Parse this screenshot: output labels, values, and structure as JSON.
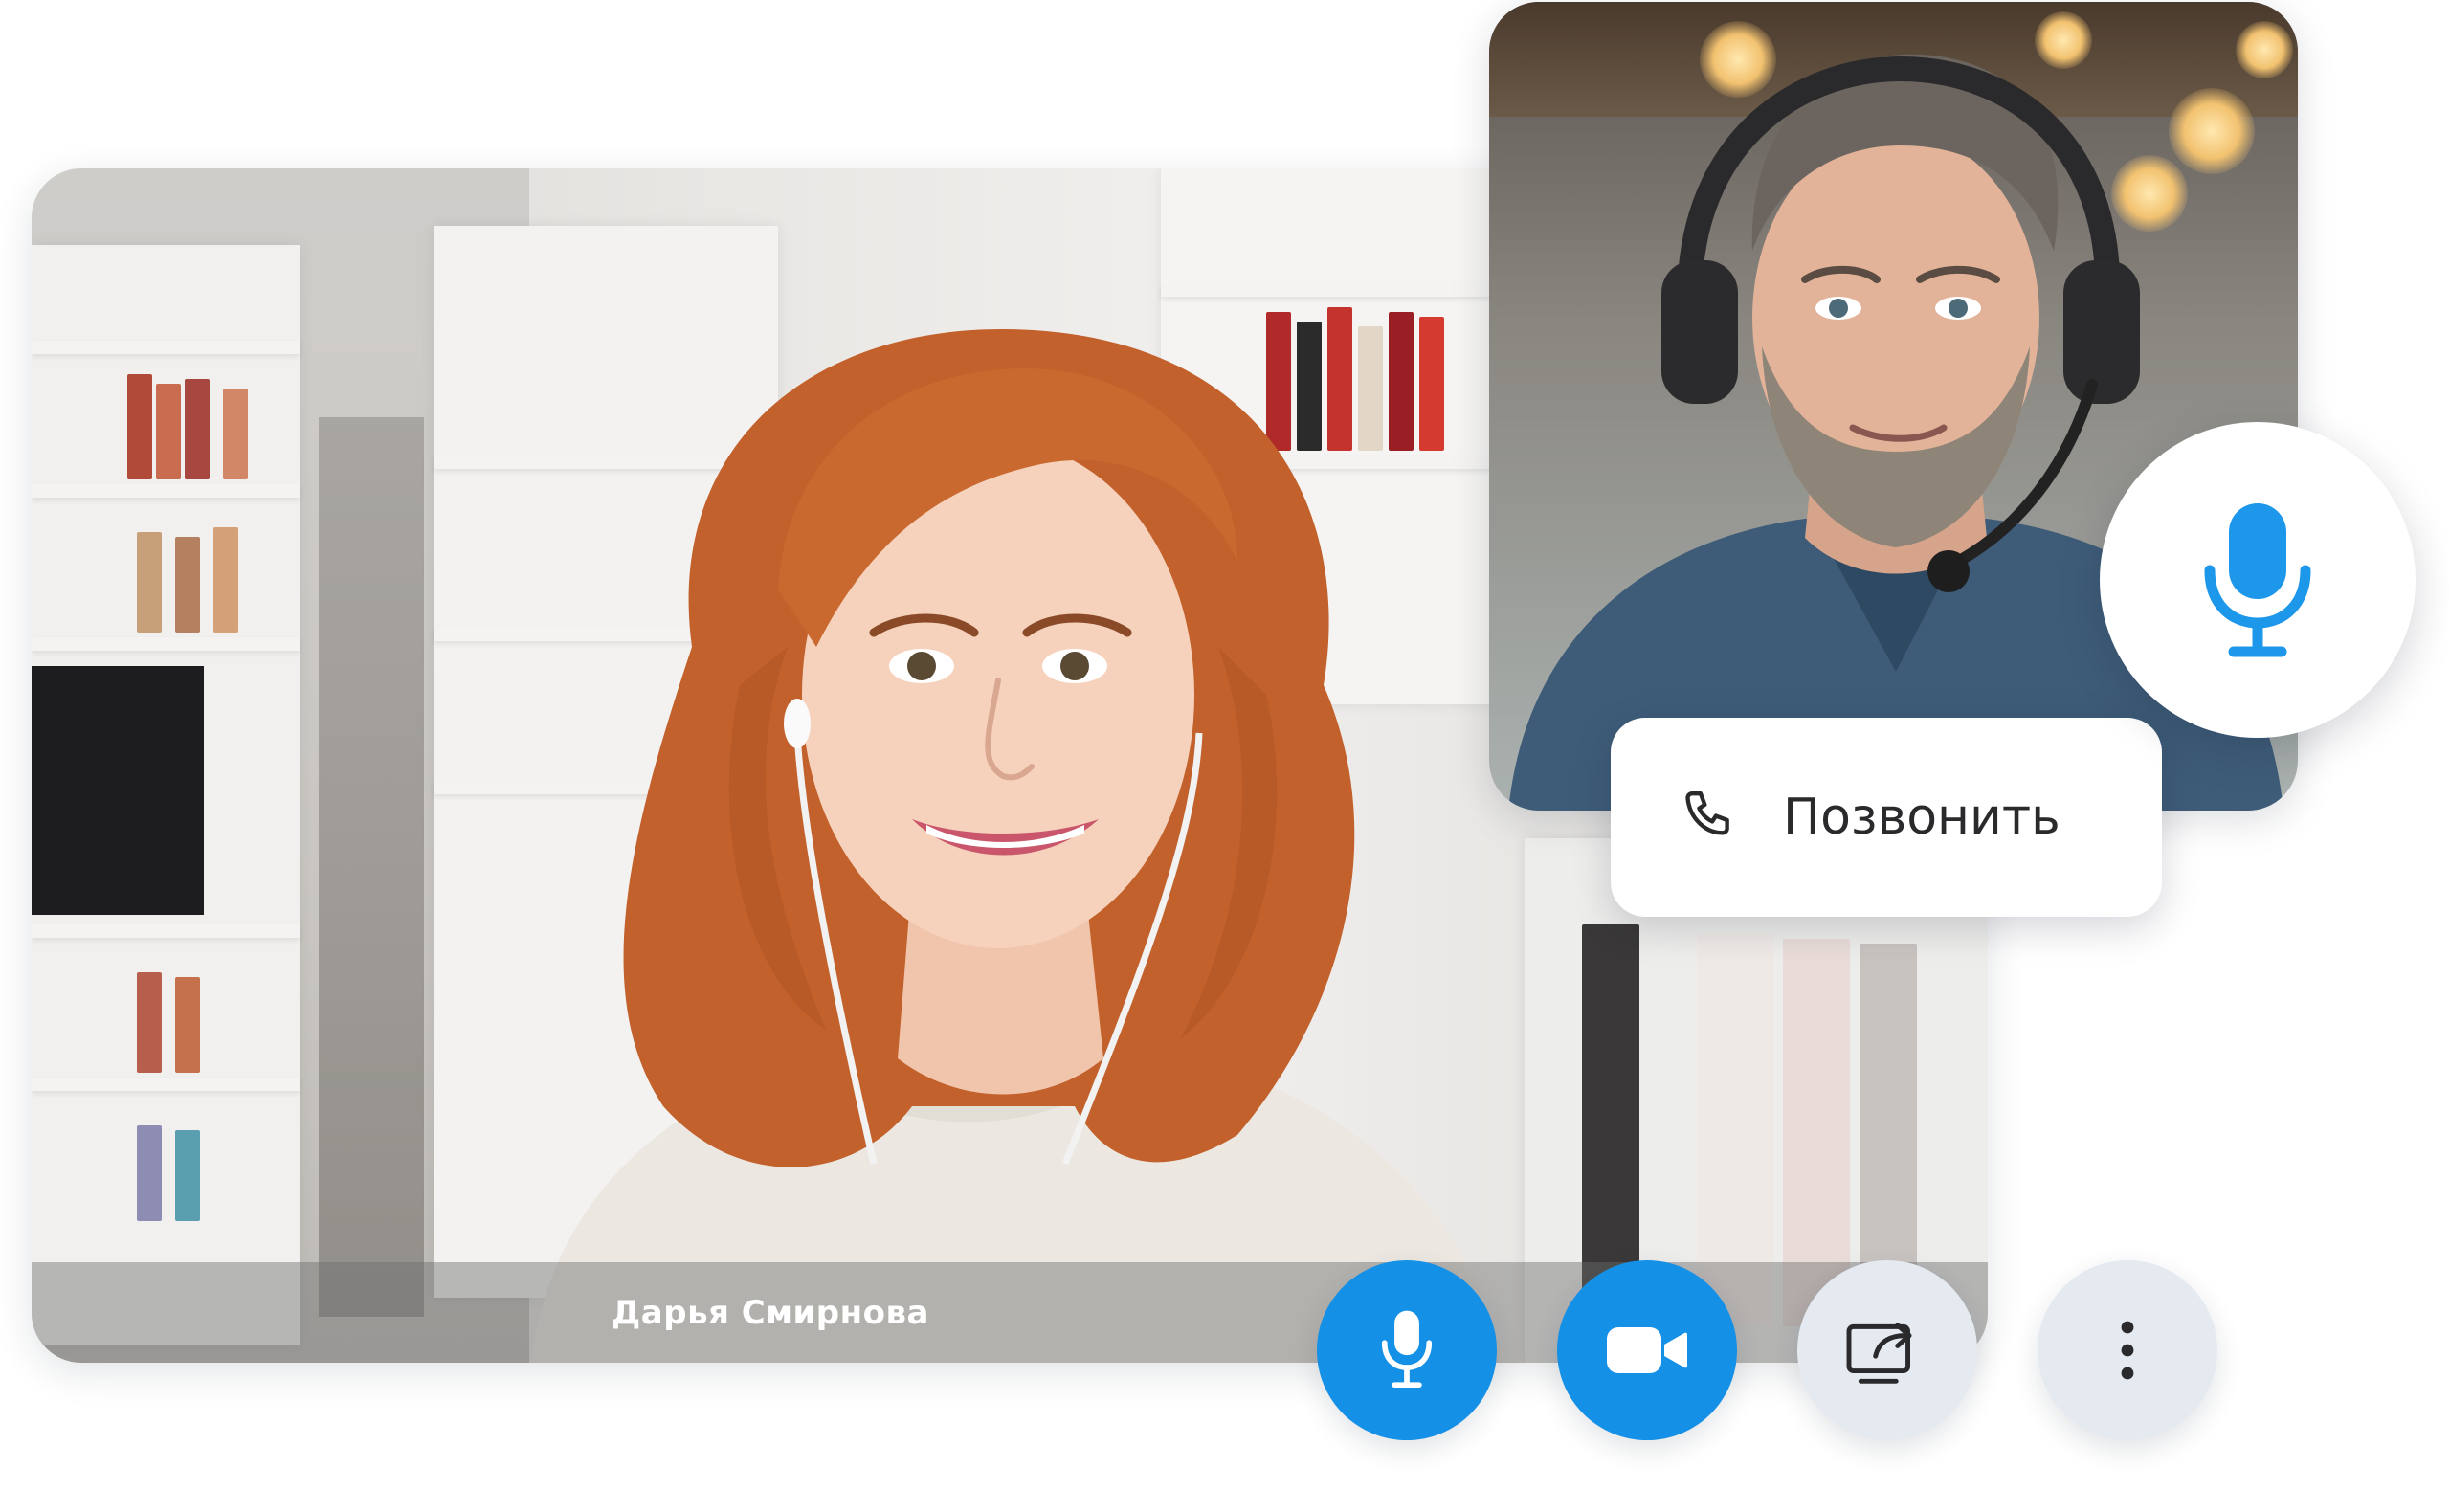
{
  "participants": {
    "main": {
      "name": "Дарья Смирнова"
    },
    "secondary": {
      "mic_icon": "microphone-icon"
    }
  },
  "call_action": {
    "label": "Позвонить",
    "icon": "phone-icon"
  },
  "controls": [
    {
      "id": "mic",
      "icon": "microphone-icon",
      "style": "active",
      "color": "#1490e6"
    },
    {
      "id": "camera",
      "icon": "video-camera-icon",
      "style": "active",
      "color": "#1490e6"
    },
    {
      "id": "share",
      "icon": "screen-share-icon",
      "style": "inactive",
      "color": "#e5eaf1"
    },
    {
      "id": "more",
      "icon": "more-vertical-icon",
      "style": "inactive",
      "color": "#e5eaf1"
    }
  ],
  "colors": {
    "accent": "#1490e6",
    "control_inactive": "#e5eaf1",
    "icon_dark": "#2a2a2d",
    "mic_float_icon": "#1d97ea"
  }
}
